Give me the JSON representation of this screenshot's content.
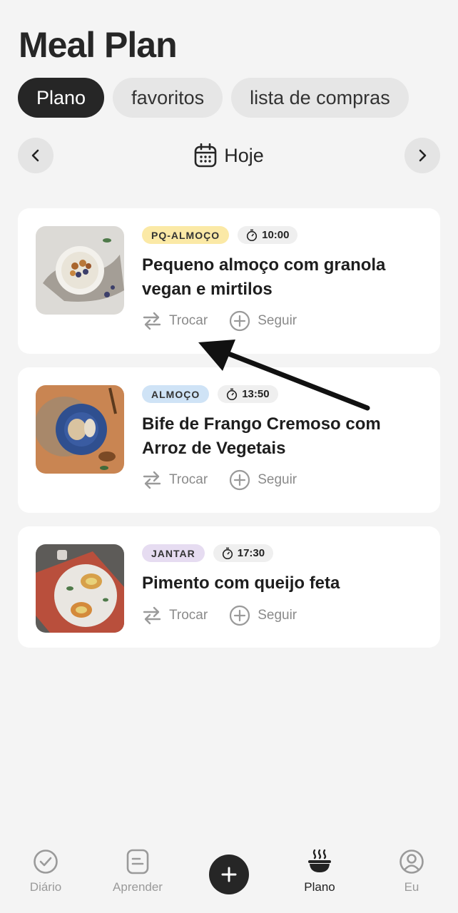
{
  "page": {
    "title": "Meal Plan"
  },
  "tabs": [
    {
      "label": "Plano",
      "active": true
    },
    {
      "label": "favoritos",
      "active": false
    },
    {
      "label": "lista de compras",
      "active": false
    }
  ],
  "date_nav": {
    "label": "Hoje",
    "icon": "calendar-icon"
  },
  "meals": [
    {
      "badge": "PQ-ALMOÇO",
      "badge_color": "#fbe9a6",
      "time": "10:00",
      "name": "Pequeno almoço com granola vegan e mirtilos",
      "swap_label": "Trocar",
      "follow_label": "Seguir"
    },
    {
      "badge": "ALMOÇO",
      "badge_color": "#cfe3f6",
      "time": "13:50",
      "name": "Bife de Frango Cremoso com Arroz de Vegetais",
      "swap_label": "Trocar",
      "follow_label": "Seguir"
    },
    {
      "badge": "JANTAR",
      "badge_color": "#e6dcf1",
      "time": "17:30",
      "name": "Pimento com queijo feta",
      "swap_label": "Trocar",
      "follow_label": "Seguir"
    }
  ],
  "bottom_nav": [
    {
      "label": "Diário",
      "icon": "check-circle-icon",
      "active": false
    },
    {
      "label": "Aprender",
      "icon": "document-icon",
      "active": false
    },
    {
      "label": "Plano",
      "icon": "bowl-icon",
      "active": true
    },
    {
      "label": "Eu",
      "icon": "user-icon",
      "active": false
    }
  ],
  "fab": {
    "icon": "plus-icon"
  }
}
